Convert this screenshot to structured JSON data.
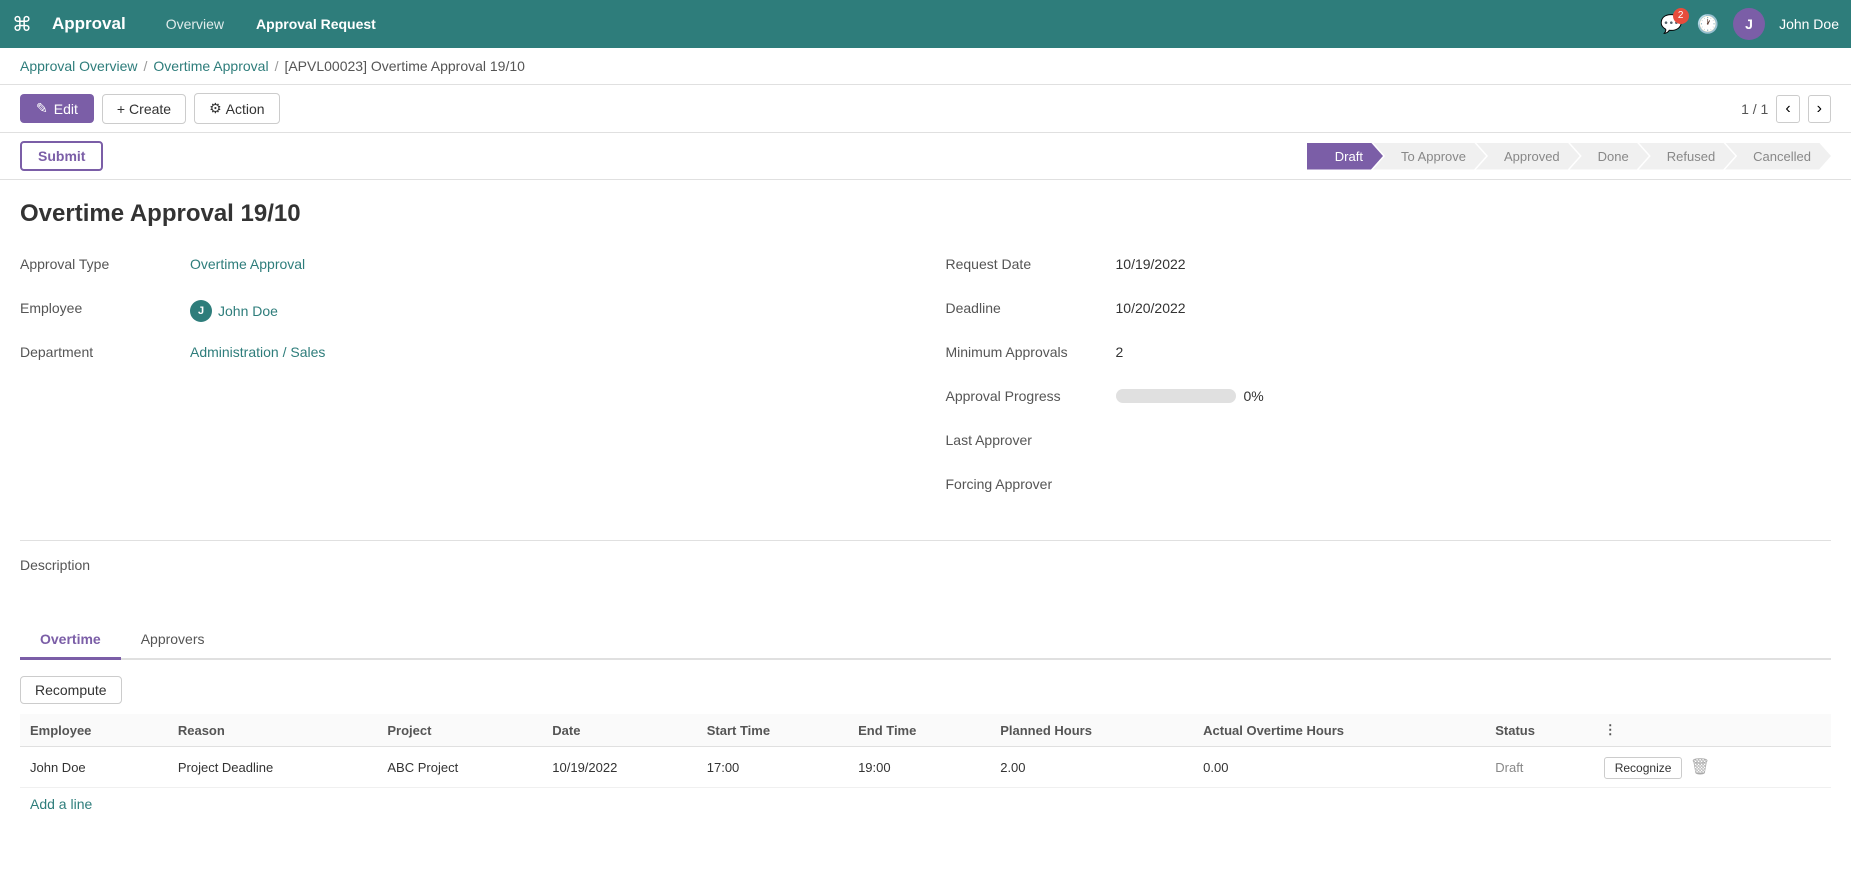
{
  "topNav": {
    "appTitle": "Approval",
    "links": [
      {
        "id": "overview",
        "label": "Overview",
        "active": false
      },
      {
        "id": "approval-request",
        "label": "Approval Request",
        "active": true
      }
    ],
    "messageBadge": "2",
    "userInitial": "J",
    "userName": "John Doe"
  },
  "breadcrumb": {
    "items": [
      {
        "id": "approval-overview",
        "label": "Approval Overview"
      },
      {
        "id": "overtime-approval",
        "label": "Overtime Approval"
      },
      {
        "id": "current",
        "label": "[APVL00023] Overtime Approval 19/10"
      }
    ]
  },
  "toolbar": {
    "editLabel": "Edit",
    "createLabel": "Create",
    "actionLabel": "Action",
    "pagination": "1 / 1"
  },
  "statusPipeline": {
    "steps": [
      {
        "id": "draft",
        "label": "Draft",
        "active": true
      },
      {
        "id": "to-approve",
        "label": "To Approve",
        "active": false
      },
      {
        "id": "approved",
        "label": "Approved",
        "active": false
      },
      {
        "id": "done",
        "label": "Done",
        "active": false
      },
      {
        "id": "refused",
        "label": "Refused",
        "active": false
      },
      {
        "id": "cancelled",
        "label": "Cancelled",
        "active": false
      }
    ]
  },
  "submitButton": "Submit",
  "form": {
    "title": "Overtime Approval 19/10",
    "leftFields": [
      {
        "id": "approval-type",
        "label": "Approval Type",
        "value": "Overtime Approval",
        "colored": true
      },
      {
        "id": "employee",
        "label": "Employee",
        "value": "John Doe",
        "hasAvatar": true,
        "colored": true
      },
      {
        "id": "department",
        "label": "Department",
        "value": "Administration / Sales",
        "colored": true
      }
    ],
    "rightFields": [
      {
        "id": "request-date",
        "label": "Request Date",
        "value": "10/19/2022",
        "colored": false
      },
      {
        "id": "deadline",
        "label": "Deadline",
        "value": "10/20/2022",
        "colored": false
      },
      {
        "id": "minimum-approvals",
        "label": "Minimum Approvals",
        "value": "2",
        "colored": false
      },
      {
        "id": "approval-progress",
        "label": "Approval Progress",
        "value": "0%",
        "progressBar": true,
        "progressPct": 0
      },
      {
        "id": "last-approver",
        "label": "Last Approver",
        "value": "",
        "colored": false
      },
      {
        "id": "forcing-approver",
        "label": "Forcing Approver",
        "value": "",
        "colored": false
      }
    ]
  },
  "description": {
    "label": "Description",
    "value": ""
  },
  "tabs": [
    {
      "id": "overtime",
      "label": "Overtime",
      "active": true
    },
    {
      "id": "approvers",
      "label": "Approvers",
      "active": false
    }
  ],
  "recomputeButton": "Recompute",
  "table": {
    "columns": [
      {
        "id": "employee",
        "label": "Employee"
      },
      {
        "id": "reason",
        "label": "Reason"
      },
      {
        "id": "project",
        "label": "Project"
      },
      {
        "id": "date",
        "label": "Date"
      },
      {
        "id": "start-time",
        "label": "Start Time"
      },
      {
        "id": "end-time",
        "label": "End Time"
      },
      {
        "id": "planned-hours",
        "label": "Planned Hours"
      },
      {
        "id": "actual-overtime-hours",
        "label": "Actual Overtime Hours"
      },
      {
        "id": "status",
        "label": "Status"
      },
      {
        "id": "actions",
        "label": ""
      }
    ],
    "rows": [
      {
        "employee": "John Doe",
        "reason": "Project Deadline",
        "project": "ABC Project",
        "date": "10/19/2022",
        "startTime": "17:00",
        "endTime": "19:00",
        "plannedHours": "2.00",
        "actualOvertimeHours": "0.00",
        "status": "Draft",
        "recognizeLabel": "Recognize"
      }
    ],
    "addLineLabel": "Add a line"
  }
}
